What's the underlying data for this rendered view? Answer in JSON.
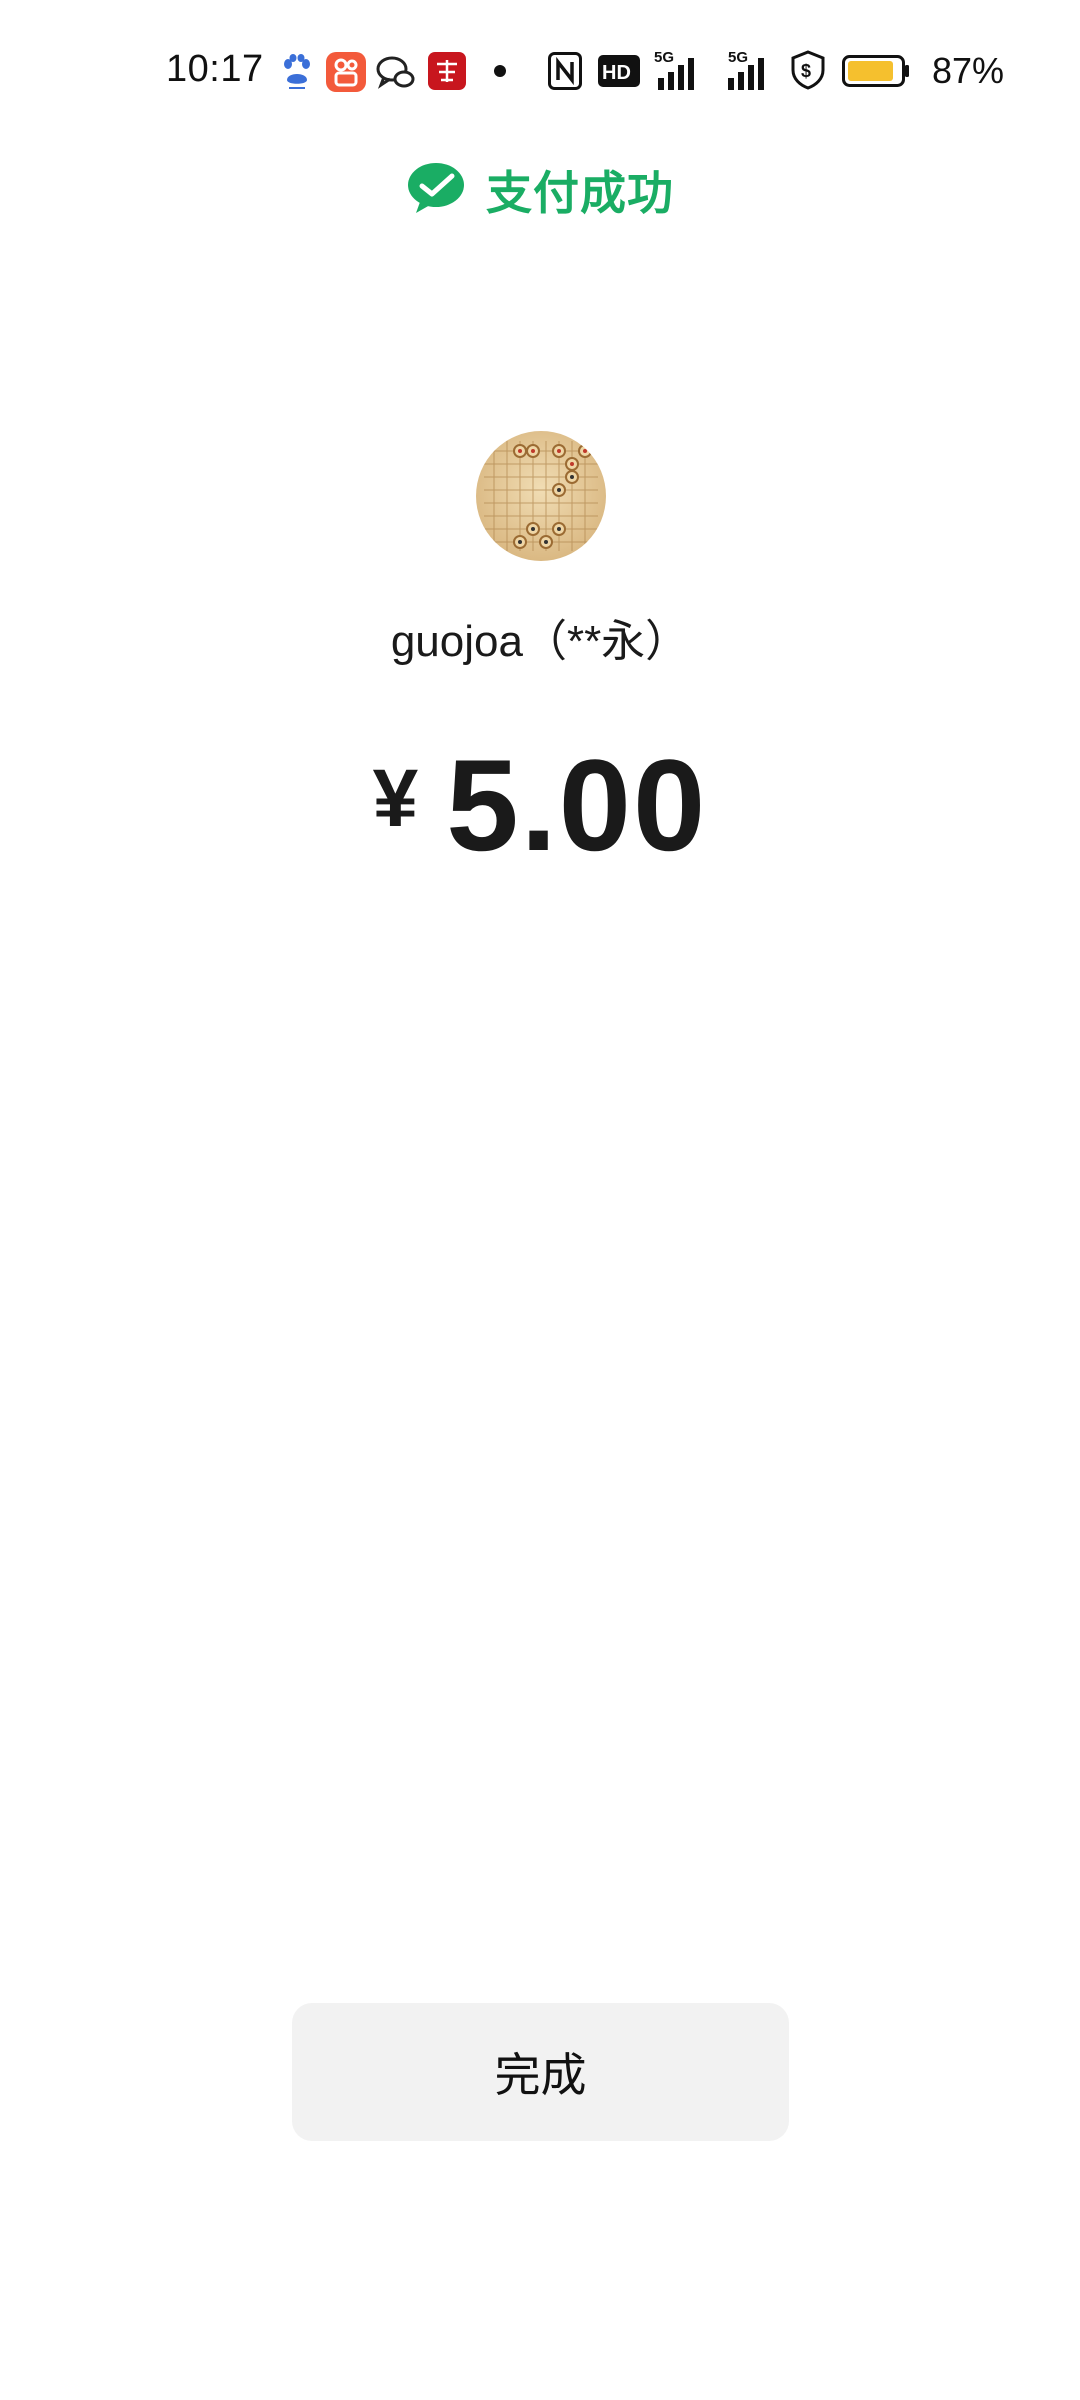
{
  "status_bar": {
    "time": "10:17",
    "battery_percent": "87%",
    "notification_icons": [
      "baidu-icon",
      "kuaishou-icon",
      "wechat-bubble-icon",
      "xuexi-icon",
      "dot-icon"
    ],
    "system_icons": [
      "nfc-icon",
      "hd-icon",
      "5g-signal-icon",
      "5g-signal-icon",
      "security-shield-icon",
      "battery-icon"
    ],
    "network_labels": {
      "hd": "HD",
      "fiveg": "5G"
    },
    "battery_color": "#f5c02e"
  },
  "header": {
    "title": "支付成功",
    "accent_color": "#1aad64"
  },
  "payee": {
    "name": "guojoa（**永）",
    "avatar_icon": "chess-board-avatar"
  },
  "payment": {
    "currency_symbol": "¥",
    "amount": "5.00"
  },
  "actions": {
    "done_label": "完成"
  }
}
